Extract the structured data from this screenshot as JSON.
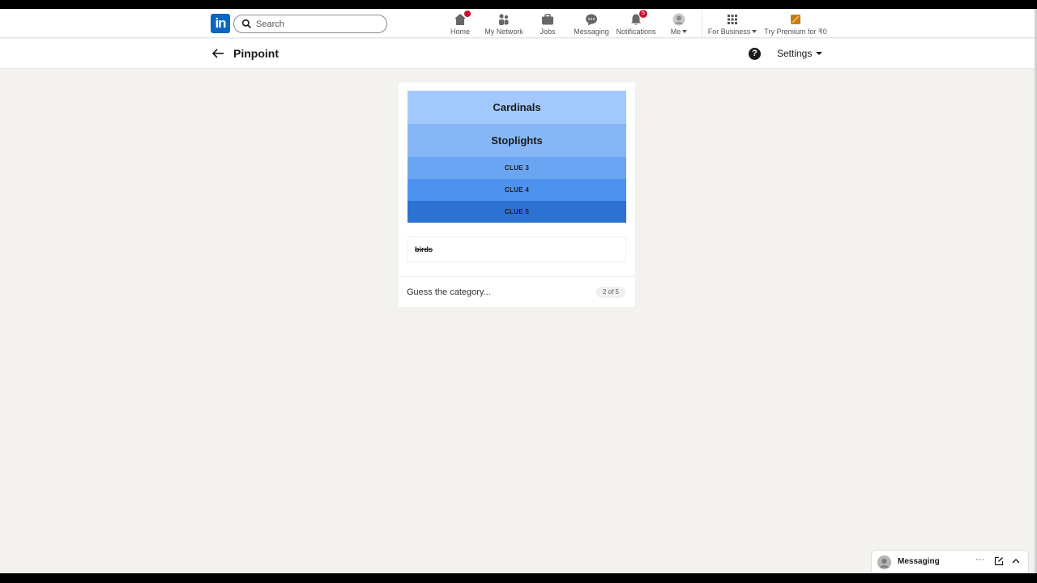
{
  "nav": {
    "logo_text": "in",
    "search_placeholder": "Search",
    "items": [
      {
        "label": "Home",
        "icon": "home-icon",
        "badge": ""
      },
      {
        "label": "My Network",
        "icon": "network-icon",
        "badge": ""
      },
      {
        "label": "Jobs",
        "icon": "jobs-icon",
        "badge": ""
      },
      {
        "label": "Messaging",
        "icon": "messaging-icon",
        "badge": ""
      },
      {
        "label": "Notifications",
        "icon": "bell-icon",
        "badge": "5"
      },
      {
        "label": "Me",
        "icon": "avatar-icon",
        "badge": ""
      }
    ],
    "business_label": "For Business",
    "premium_label": "Try Premium for ₹0"
  },
  "header": {
    "title": "Pinpoint",
    "settings_label": "Settings",
    "help_symbol": "?"
  },
  "game": {
    "clues": [
      {
        "text": "Cardinals",
        "revealed": true,
        "color": "#a3c8fb"
      },
      {
        "text": "Stoplights",
        "revealed": true,
        "color": "#86b6f6"
      },
      {
        "text": "CLUE 3",
        "revealed": false,
        "color": "#6aa5f3"
      },
      {
        "text": "CLUE 4",
        "revealed": false,
        "color": "#4d92ee"
      },
      {
        "text": "CLUE 5",
        "revealed": false,
        "color": "#2d72d2"
      }
    ],
    "previous_guess": "birds",
    "input_placeholder": "Guess the category...",
    "counter": "2 of 5"
  },
  "messaging": {
    "label": "Messaging",
    "more_symbol": "···"
  }
}
